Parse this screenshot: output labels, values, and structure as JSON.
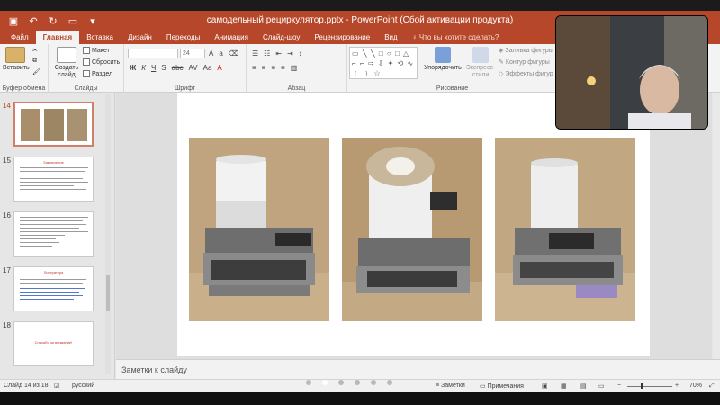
{
  "titlebar": {
    "document_title": "самодельный рециркулятор.pptx - PowerPoint (Сбой активации продукта)"
  },
  "tabs": [
    {
      "label": "Файл"
    },
    {
      "label": "Главная"
    },
    {
      "label": "Вставка"
    },
    {
      "label": "Дизайн"
    },
    {
      "label": "Переходы"
    },
    {
      "label": "Анимация"
    },
    {
      "label": "Слайд-шоу"
    },
    {
      "label": "Рецензирование"
    },
    {
      "label": "Вид"
    }
  ],
  "tell_me": "Что вы хотите сделать?",
  "ribbon": {
    "clipboard": {
      "paste": "Вставить",
      "group": "Буфер обмена"
    },
    "slides": {
      "new_slide": "Создать слайд",
      "layout": "Макет",
      "reset": "Сбросить",
      "section": "Раздел",
      "group": "Слайды"
    },
    "font": {
      "size": "24",
      "group": "Шрифт"
    },
    "paragraph": {
      "group": "Абзац"
    },
    "drawing": {
      "arrange": "Упорядочить",
      "quick_styles": "Экспресс-стили",
      "fill": "Заливка фигуры",
      "outline": "Контур фигуры",
      "effects": "Эффекты фигур",
      "group": "Рисование"
    }
  },
  "thumbnails": [
    {
      "num": "14",
      "selected": true
    },
    {
      "num": "15",
      "title": "Заключение"
    },
    {
      "num": "16"
    },
    {
      "num": "17",
      "title": "Литература"
    },
    {
      "num": "18",
      "title": "Спасибо за внимание!"
    }
  ],
  "notes": {
    "placeholder": "Заметки к слайду"
  },
  "status": {
    "slide_counter": "Слайд 14 из 18",
    "language": "русский",
    "notes_btn": "Заметки",
    "comments_btn": "Примечания",
    "zoom": "70%"
  },
  "colors": {
    "accent": "#b7472a"
  }
}
